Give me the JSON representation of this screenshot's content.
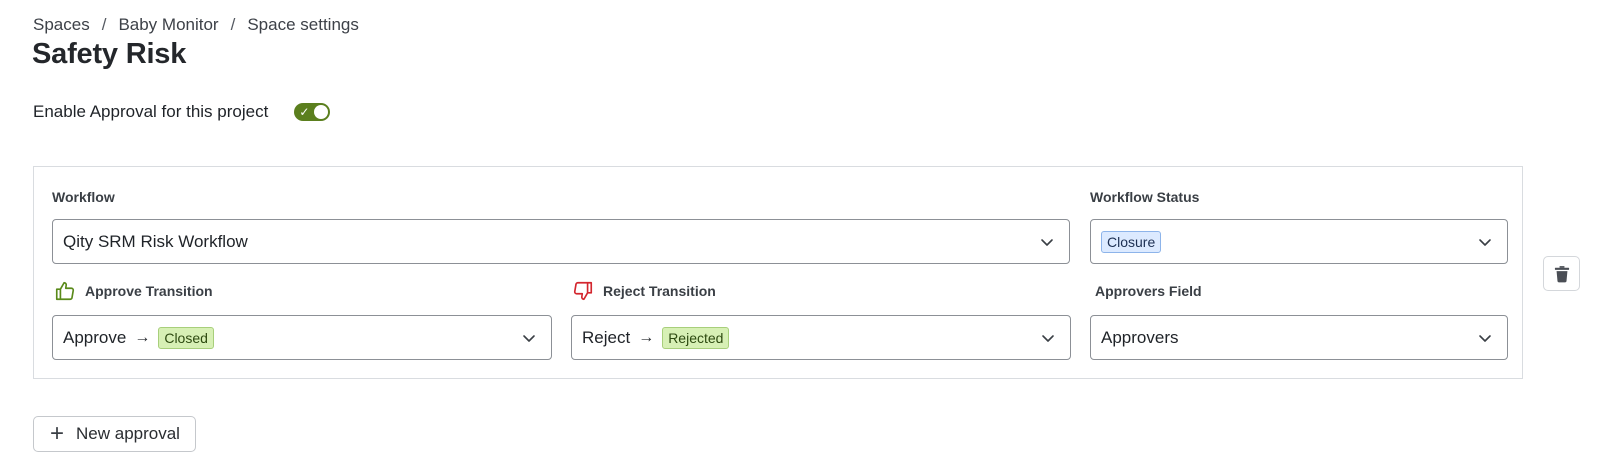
{
  "breadcrumb": {
    "items": [
      "Spaces",
      "Baby Monitor",
      "Space settings"
    ],
    "separator": "/"
  },
  "page": {
    "title": "Safety Risk"
  },
  "approval_toggle": {
    "label": "Enable Approval for this project",
    "enabled": true
  },
  "card": {
    "workflow": {
      "label": "Workflow",
      "value": "Qity SRM Risk Workflow"
    },
    "workflow_status": {
      "label": "Workflow Status",
      "value": "Closure"
    },
    "approve_transition": {
      "label": "Approve Transition",
      "action": "Approve",
      "target": "Closed"
    },
    "reject_transition": {
      "label": "Reject Transition",
      "action": "Reject",
      "target": "Rejected"
    },
    "approvers_field": {
      "label": "Approvers Field",
      "value": "Approvers"
    }
  },
  "buttons": {
    "new_approval": "New approval"
  },
  "colors": {
    "toggle_on": "#5b7f1e",
    "approve_icon": "#5a8a1a",
    "reject_icon": "#d3262e",
    "tag_blue_bg": "#dceaff",
    "tag_green_bg": "#d7f0b5"
  },
  "icons": {
    "approve": "thumbs-up-icon",
    "reject": "thumbs-down-icon",
    "delete": "trash-icon",
    "dropdown": "chevron-down-icon",
    "add": "plus-icon"
  }
}
